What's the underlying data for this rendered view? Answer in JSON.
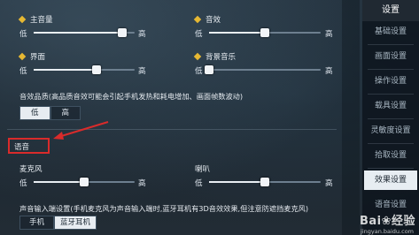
{
  "master_volume": {
    "label": "主音量",
    "low": "低",
    "high": "高",
    "level": 0.88
  },
  "sfx_volume": {
    "label": "音效",
    "low": "低",
    "high": "高",
    "level": 0.5
  },
  "ui_volume": {
    "label": "界面",
    "low": "低",
    "high": "高",
    "level": 0.62
  },
  "bg_music": {
    "label": "背景音乐",
    "low": "低",
    "high": "高",
    "level": 0.0
  },
  "sfx_quality": {
    "note": "音效品质(高品质音效可能会引起手机发热和耗电增加、画面帧数波动)",
    "options": [
      "低",
      "高"
    ],
    "selected": "低"
  },
  "voice_section": {
    "label": "语音"
  },
  "mic": {
    "label": "麦克风",
    "low": "低",
    "high": "高",
    "level": 0.5
  },
  "speaker": {
    "label": "喇叭",
    "low": "低",
    "high": "高",
    "level": 0.5
  },
  "voice_input": {
    "note": "声音输入端设置(手机麦克风为声音输入端时,蓝牙耳机有3D音效效果,但注意防遮挡麦克风)",
    "options": [
      "手机",
      "蓝牙耳机"
    ],
    "selected": "蓝牙耳机"
  },
  "menu": {
    "title": "设置",
    "items": [
      "基础设置",
      "画面设置",
      "操作设置",
      "载具设置",
      "灵敏度设置",
      "拾取设置",
      "效果设置",
      "语音设置"
    ],
    "active": "效果设置"
  },
  "watermark": {
    "text": "Bai❀经验",
    "sub": "jingyan.baidu.com"
  },
  "colors": {
    "accent": "#e6b833",
    "highlight_box": "#d92b2b",
    "active_bg": "#e7edf2"
  }
}
